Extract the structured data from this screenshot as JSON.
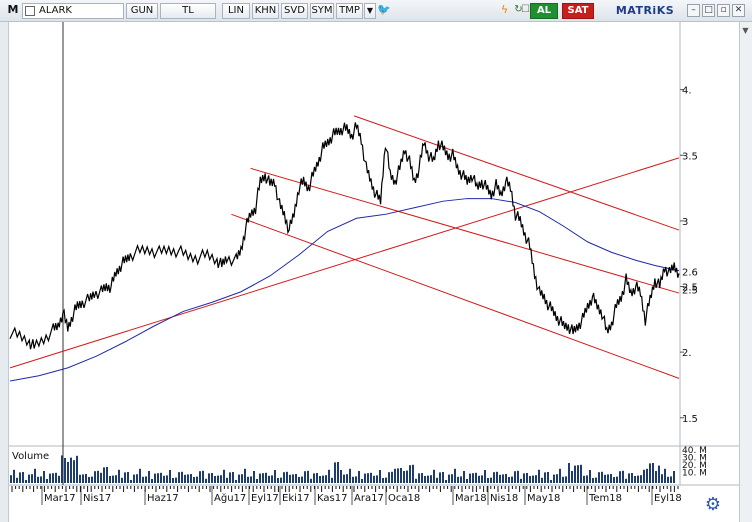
{
  "toolbar": {
    "m_label": "M",
    "symbol": "ALARK",
    "buttons": [
      "GUN",
      "TL",
      "LIN",
      "KHN",
      "SVD",
      "SYM",
      "TMP"
    ],
    "buy": "AL",
    "sell": "SAT",
    "brand": "MATRiKS"
  },
  "chart_data": {
    "type": "line",
    "ylim": [
      1.3,
      4.5
    ],
    "y_ticks": [
      "4.",
      "3.5",
      "3",
      "2.5",
      "2.",
      "1.5"
    ],
    "y_tick_values": [
      4.0,
      3.5,
      3.0,
      2.5,
      2.0,
      1.5
    ],
    "price_labels": [
      "2.6",
      "2.5"
    ],
    "price_label_values": [
      2.6,
      2.5
    ],
    "x_labels": [
      "Mar17",
      "Nis17",
      "Haz17",
      "Ağu17",
      "Eyl17",
      "Eki17",
      "Kas17",
      "Ara17",
      "Oca18",
      "Mar18",
      "Nis18",
      "May18",
      "Tem18",
      "Eyl18"
    ],
    "volume_label": "Volume",
    "volume_ticks": [
      "40. M",
      "30. M",
      "20. M",
      "10. M"
    ],
    "series_price": [
      [
        0,
        2.15
      ],
      [
        4,
        2.12
      ],
      [
        8,
        2.08
      ],
      [
        10,
        2.04
      ],
      [
        14,
        2.1
      ],
      [
        18,
        2.17
      ],
      [
        20,
        2.2
      ],
      [
        22,
        2.3
      ],
      [
        24,
        2.18
      ],
      [
        26,
        2.28
      ],
      [
        28,
        2.35
      ],
      [
        30,
        2.38
      ],
      [
        33,
        2.4
      ],
      [
        35,
        2.45
      ],
      [
        38,
        2.46
      ],
      [
        40,
        2.5
      ],
      [
        42,
        2.5
      ],
      [
        44,
        2.6
      ],
      [
        46,
        2.66
      ],
      [
        48,
        2.7
      ],
      [
        50,
        2.74
      ],
      [
        54,
        2.77
      ],
      [
        58,
        2.78
      ],
      [
        62,
        2.76
      ],
      [
        66,
        2.78
      ],
      [
        70,
        2.77
      ],
      [
        74,
        2.73
      ],
      [
        78,
        2.72
      ],
      [
        82,
        2.74
      ],
      [
        86,
        2.7
      ],
      [
        88,
        2.66
      ],
      [
        90,
        2.72
      ],
      [
        94,
        2.7
      ],
      [
        96,
        2.78
      ],
      [
        98,
        2.95
      ],
      [
        100,
        3.05
      ],
      [
        102,
        3.1
      ],
      [
        104,
        3.3
      ],
      [
        106,
        3.35
      ],
      [
        108,
        3.28
      ],
      [
        110,
        3.3
      ],
      [
        112,
        3.12
      ],
      [
        114,
        3.05
      ],
      [
        116,
        2.93
      ],
      [
        118,
        3.05
      ],
      [
        120,
        3.25
      ],
      [
        122,
        3.3
      ],
      [
        124,
        3.25
      ],
      [
        126,
        3.35
      ],
      [
        128,
        3.45
      ],
      [
        130,
        3.55
      ],
      [
        132,
        3.6
      ],
      [
        134,
        3.65
      ],
      [
        136,
        3.68
      ],
      [
        138,
        3.7
      ],
      [
        140,
        3.7
      ],
      [
        142,
        3.65
      ],
      [
        144,
        3.72
      ],
      [
        146,
        3.62
      ],
      [
        148,
        3.4
      ],
      [
        150,
        3.3
      ],
      [
        152,
        3.2
      ],
      [
        154,
        3.15
      ],
      [
        156,
        3.6
      ],
      [
        158,
        3.35
      ],
      [
        160,
        3.3
      ],
      [
        162,
        3.4
      ],
      [
        164,
        3.55
      ],
      [
        166,
        3.45
      ],
      [
        168,
        3.3
      ],
      [
        170,
        3.4
      ],
      [
        172,
        3.6
      ],
      [
        174,
        3.5
      ],
      [
        176,
        3.45
      ],
      [
        178,
        3.6
      ],
      [
        180,
        3.55
      ],
      [
        182,
        3.5
      ],
      [
        184,
        3.5
      ],
      [
        186,
        3.4
      ],
      [
        188,
        3.35
      ],
      [
        190,
        3.3
      ],
      [
        192,
        3.35
      ],
      [
        194,
        3.25
      ],
      [
        196,
        3.3
      ],
      [
        198,
        3.25
      ],
      [
        200,
        3.2
      ],
      [
        202,
        3.27
      ],
      [
        204,
        3.2
      ],
      [
        206,
        3.3
      ],
      [
        208,
        3.25
      ],
      [
        210,
        3.05
      ],
      [
        212,
        3.0
      ],
      [
        214,
        2.9
      ],
      [
        216,
        2.8
      ],
      [
        218,
        2.6
      ],
      [
        220,
        2.45
      ],
      [
        222,
        2.42
      ],
      [
        224,
        2.35
      ],
      [
        226,
        2.3
      ],
      [
        228,
        2.25
      ],
      [
        230,
        2.2
      ],
      [
        232,
        2.2
      ],
      [
        234,
        2.15
      ],
      [
        236,
        2.2
      ],
      [
        238,
        2.25
      ],
      [
        240,
        2.35
      ],
      [
        242,
        2.42
      ],
      [
        244,
        2.35
      ],
      [
        246,
        2.3
      ],
      [
        248,
        2.15
      ],
      [
        250,
        2.22
      ],
      [
        252,
        2.35
      ],
      [
        254,
        2.42
      ],
      [
        256,
        2.55
      ],
      [
        258,
        2.45
      ],
      [
        260,
        2.5
      ],
      [
        262,
        2.45
      ],
      [
        264,
        2.25
      ],
      [
        266,
        2.4
      ],
      [
        268,
        2.55
      ],
      [
        270,
        2.5
      ],
      [
        272,
        2.65
      ],
      [
        274,
        2.6
      ],
      [
        276,
        2.66
      ],
      [
        278,
        2.6
      ]
    ],
    "series_ma": [
      [
        0,
        1.78
      ],
      [
        12,
        1.82
      ],
      [
        24,
        1.88
      ],
      [
        36,
        1.97
      ],
      [
        48,
        2.08
      ],
      [
        60,
        2.2
      ],
      [
        72,
        2.31
      ],
      [
        84,
        2.38
      ],
      [
        96,
        2.46
      ],
      [
        108,
        2.58
      ],
      [
        120,
        2.74
      ],
      [
        132,
        2.92
      ],
      [
        144,
        3.02
      ],
      [
        156,
        3.05
      ],
      [
        168,
        3.1
      ],
      [
        180,
        3.15
      ],
      [
        190,
        3.17
      ],
      [
        200,
        3.17
      ],
      [
        210,
        3.14
      ],
      [
        220,
        3.07
      ],
      [
        230,
        2.96
      ],
      [
        240,
        2.84
      ],
      [
        250,
        2.76
      ],
      [
        260,
        2.7
      ],
      [
        268,
        2.66
      ],
      [
        278,
        2.62
      ]
    ],
    "trendlines": [
      {
        "x1": 0,
        "y1": 1.88,
        "x2": 278,
        "y2": 3.48
      },
      {
        "x1": 143,
        "y1": 3.8,
        "x2": 278,
        "y2": 2.93
      },
      {
        "x1": 100,
        "y1": 3.4,
        "x2": 278,
        "y2": 2.45
      },
      {
        "x1": 92,
        "y1": 3.05,
        "x2": 278,
        "y2": 1.8
      }
    ],
    "colors": {
      "price": "#000000",
      "ma": "#1f2aa8",
      "trend": "#d21b1b",
      "volume": "#1e3c6e"
    }
  }
}
